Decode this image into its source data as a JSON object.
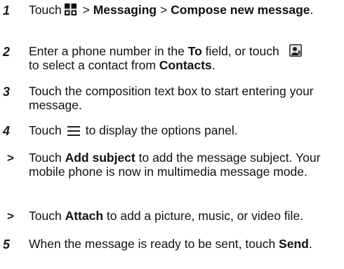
{
  "steps": [
    {
      "marker": "1",
      "t1": "Touch",
      "t2": ">",
      "b1": "Messaging",
      "t3": ">",
      "b2": "Compose new message",
      "t4": ".",
      "icon": "app-grid-icon"
    },
    {
      "marker": "2",
      "t1": "Enter a phone number in the",
      "b1": "To",
      "t2": "field, or touch",
      "t3": "to select a contact from",
      "b2": "Contacts",
      "t4": ".",
      "icon": "contact-picker-icon"
    },
    {
      "marker": "3",
      "text": "Touch the composition text box to start entering your message."
    },
    {
      "marker": "4",
      "t1": "Touch",
      "t2": "to display the options panel.",
      "icon": "menu-icon"
    },
    {
      "marker": ">",
      "t1": "Touch",
      "b1": "Add subject",
      "t2": "to add the message subject. Your mobile phone is now in multimedia message mode."
    },
    {
      "marker": ">",
      "t1": "Touch",
      "b1": "Attach",
      "t2": "to add a picture, music, or video file."
    },
    {
      "marker": "5",
      "t1": "When the message is ready to be sent, touch",
      "b1": "Send",
      "t2": "."
    }
  ]
}
